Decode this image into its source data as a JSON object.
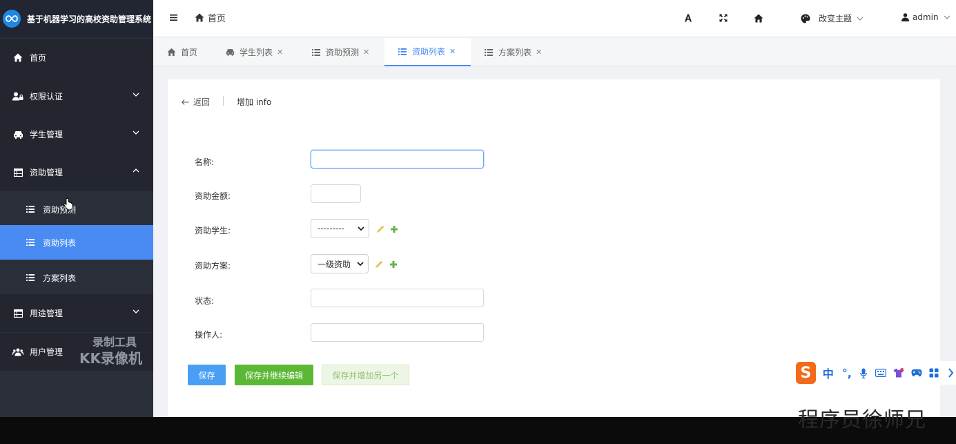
{
  "app": {
    "title": "基于机器学习的高校资助管理系统"
  },
  "sidebar": {
    "items": [
      {
        "label": "首页",
        "icon": "home-icon"
      },
      {
        "label": "权限认证",
        "icon": "user-lock-icon"
      },
      {
        "label": "学生管理",
        "icon": "car-icon"
      },
      {
        "label": "资助管理",
        "icon": "table-icon"
      },
      {
        "label": "用途管理",
        "icon": "table-icon"
      },
      {
        "label": "用户管理",
        "icon": "users-icon"
      }
    ],
    "submenu": [
      {
        "label": "资助预测"
      },
      {
        "label": "资助列表"
      },
      {
        "label": "方案列表"
      }
    ]
  },
  "header": {
    "breadcrumb": "首页",
    "theme_label": "改变主题",
    "user": "admin"
  },
  "tabs": [
    {
      "label": "首页",
      "icon": "home-icon"
    },
    {
      "label": "学生列表",
      "icon": "car-icon"
    },
    {
      "label": "资助预测",
      "icon": "list-icon"
    },
    {
      "label": "资助列表",
      "icon": "list-icon"
    },
    {
      "label": "方案列表",
      "icon": "list-icon"
    }
  ],
  "page": {
    "back_label": "返回",
    "title": "增加 info"
  },
  "form": {
    "name_label": "名称:",
    "amount_label": "资助金额:",
    "student_label": "资助学生:",
    "student_value": "---------",
    "plan_label": "资助方案:",
    "plan_value": "一级资助",
    "status_label": "状态:",
    "operator_label": "操作人:",
    "name_value": "",
    "amount_value": "",
    "status_value": "",
    "operator_value": ""
  },
  "buttons": {
    "save": "保存",
    "save_continue": "保存并继续编辑",
    "save_add": "保存并增加另一个"
  },
  "ime": {
    "mode": "中",
    "punct": "°,"
  },
  "overlay": {
    "recorder_line1": "录制工具",
    "recorder_line2": "KK录像机",
    "watermark": "程序员徐师兄"
  },
  "colors": {
    "sidebar_bg": "#2b2f3a",
    "active_blue": "#4a8bf3",
    "save_blue": "#4a9ff5",
    "continue_green": "#5bb834"
  }
}
